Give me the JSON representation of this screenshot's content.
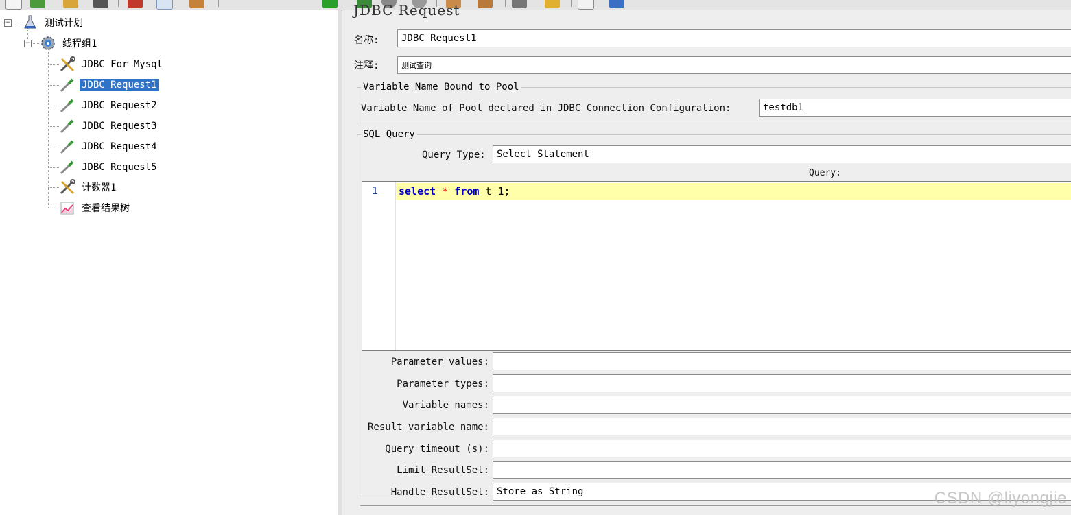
{
  "tree": {
    "items": [
      {
        "label": "测试计划",
        "icon": "test-plan-flask-icon"
      },
      {
        "label": "线程组1",
        "icon": "thread-group-gear-icon"
      },
      {
        "label": "JDBC For Mysql",
        "icon": "config-wrench-scissors-icon"
      },
      {
        "label": "JDBC Request1",
        "icon": "sampler-pipette-icon",
        "selected": true
      },
      {
        "label": "JDBC Request2",
        "icon": "sampler-pipette-icon"
      },
      {
        "label": "JDBC Request3",
        "icon": "sampler-pipette-icon"
      },
      {
        "label": "JDBC Request4",
        "icon": "sampler-pipette-icon"
      },
      {
        "label": "JDBC Request5",
        "icon": "sampler-pipette-icon"
      },
      {
        "label": "计数器1",
        "icon": "config-wrench-scissors-icon"
      },
      {
        "label": "查看结果树",
        "icon": "listener-chart-icon"
      }
    ],
    "expander_symbol": "−"
  },
  "panel": {
    "title": "JDBC Request",
    "name_label": "名称:",
    "name_value": "JDBC Request1",
    "comment_label": "注释:",
    "comment_value": "测试查询"
  },
  "pool": {
    "group_title": "Variable Name Bound to Pool",
    "label": "Variable Name of Pool declared in JDBC Connection Configuration:",
    "value": "testdb1"
  },
  "sql": {
    "group_title": "SQL Query",
    "query_type_label": "Query Type:",
    "query_type_value": "Select Statement",
    "query_label": "Query:",
    "line_number": "1",
    "code": {
      "kw1": "select",
      "star": " * ",
      "kw2": "from",
      "rest": " t_1;"
    }
  },
  "params": [
    {
      "label": "Parameter values:",
      "value": ""
    },
    {
      "label": "Parameter types:",
      "value": ""
    },
    {
      "label": "Variable names:",
      "value": ""
    },
    {
      "label": "Result variable name:",
      "value": ""
    },
    {
      "label": "Query timeout (s):",
      "value": ""
    },
    {
      "label": "Limit ResultSet:",
      "value": ""
    },
    {
      "label": "Handle ResultSet:",
      "value": "Store as String"
    }
  ],
  "watermark": "CSDN @liyongjie",
  "colors": {
    "selection": "#2f73c9",
    "code_highlight": "#ffffaa",
    "keyword": "#0000cc"
  }
}
